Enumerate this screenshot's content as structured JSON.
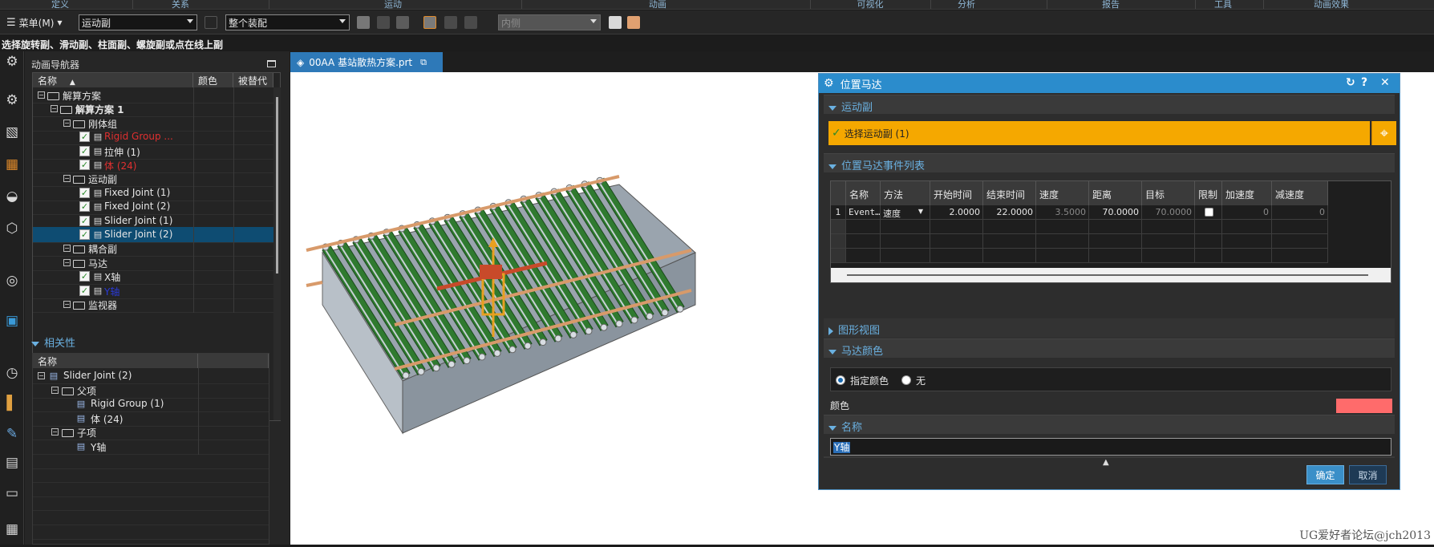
{
  "menubar": {
    "items": [
      "定义",
      "关系",
      "运动",
      "动画",
      "可视化",
      "分析",
      "报告",
      "工具",
      "动画效果"
    ]
  },
  "toolbar": {
    "menu_label": "菜单(M)",
    "filter1": "运动副",
    "filter2": "整个装配",
    "filter3": "内侧"
  },
  "status_text": "选择旋转副、滑动副、柱面副、螺旋副或点在线上副",
  "navigator": {
    "title": "动画导航器",
    "columns": [
      "名称",
      "颜色",
      "被替代"
    ],
    "rows": [
      {
        "label": "解算方案",
        "level": 0,
        "kind": "folder"
      },
      {
        "label": "解算方案 1",
        "level": 1,
        "kind": "folder",
        "bold": true
      },
      {
        "label": "刚体组",
        "level": 2,
        "kind": "folder"
      },
      {
        "label": "Rigid Group ...",
        "level": 3,
        "kind": "item",
        "color": "#e03030"
      },
      {
        "label": "拉伸 (1)",
        "level": 3,
        "kind": "item"
      },
      {
        "label": "体 (24)",
        "level": 3,
        "kind": "item",
        "color": "#e03030"
      },
      {
        "label": "运动副",
        "level": 2,
        "kind": "folder"
      },
      {
        "label": "Fixed Joint (1)",
        "level": 3,
        "kind": "item"
      },
      {
        "label": "Fixed Joint (2)",
        "level": 3,
        "kind": "item"
      },
      {
        "label": "Slider Joint (1)",
        "level": 3,
        "kind": "item"
      },
      {
        "label": "Slider Joint (2)",
        "level": 3,
        "kind": "item",
        "selected": true
      },
      {
        "label": "耦合副",
        "level": 2,
        "kind": "folder"
      },
      {
        "label": "马达",
        "level": 2,
        "kind": "folder"
      },
      {
        "label": "X轴",
        "level": 3,
        "kind": "item"
      },
      {
        "label": "Y轴",
        "level": 3,
        "kind": "item",
        "color": "#2a3ad8"
      },
      {
        "label": "监视器",
        "level": 2,
        "kind": "folder"
      }
    ]
  },
  "dependency": {
    "title": "相关性",
    "column": "名称",
    "rows": [
      {
        "label": "Slider Joint (2)",
        "level": 0
      },
      {
        "label": "父项",
        "level": 1
      },
      {
        "label": "Rigid Group (1)",
        "level": 2
      },
      {
        "label": "体 (24)",
        "level": 2
      },
      {
        "label": "子项",
        "level": 1
      },
      {
        "label": "Y轴",
        "level": 2
      }
    ]
  },
  "tab": {
    "filename": "00AA 基站散热方案.prt"
  },
  "dialog": {
    "title": "位置马达",
    "group_joint": "运动副",
    "select_joint": "选择运动副 (1)",
    "group_events": "位置马达事件列表",
    "columns": [
      "名称",
      "方法",
      "开始时间",
      "结束时间",
      "速度",
      "距离",
      "目标",
      "限制",
      "加速度",
      "减速度"
    ],
    "event": {
      "index": "1",
      "name": "Event…",
      "method": "速度",
      "start": "2.0000",
      "end": "22.0000",
      "speed": "3.5000",
      "distance": "70.0000",
      "target": "70.0000",
      "accel": "0",
      "decel": "0"
    },
    "group_graph": "图形视图",
    "group_color": "马达颜色",
    "radio_specified": "指定颜色",
    "radio_none": "无",
    "color_label": "颜色",
    "motor_color": "#ff6b6b",
    "group_name": "名称",
    "name_value": "Y轴",
    "ok": "确定",
    "cancel": "取消"
  },
  "watermark": "UG爱好者论坛@jch2013"
}
